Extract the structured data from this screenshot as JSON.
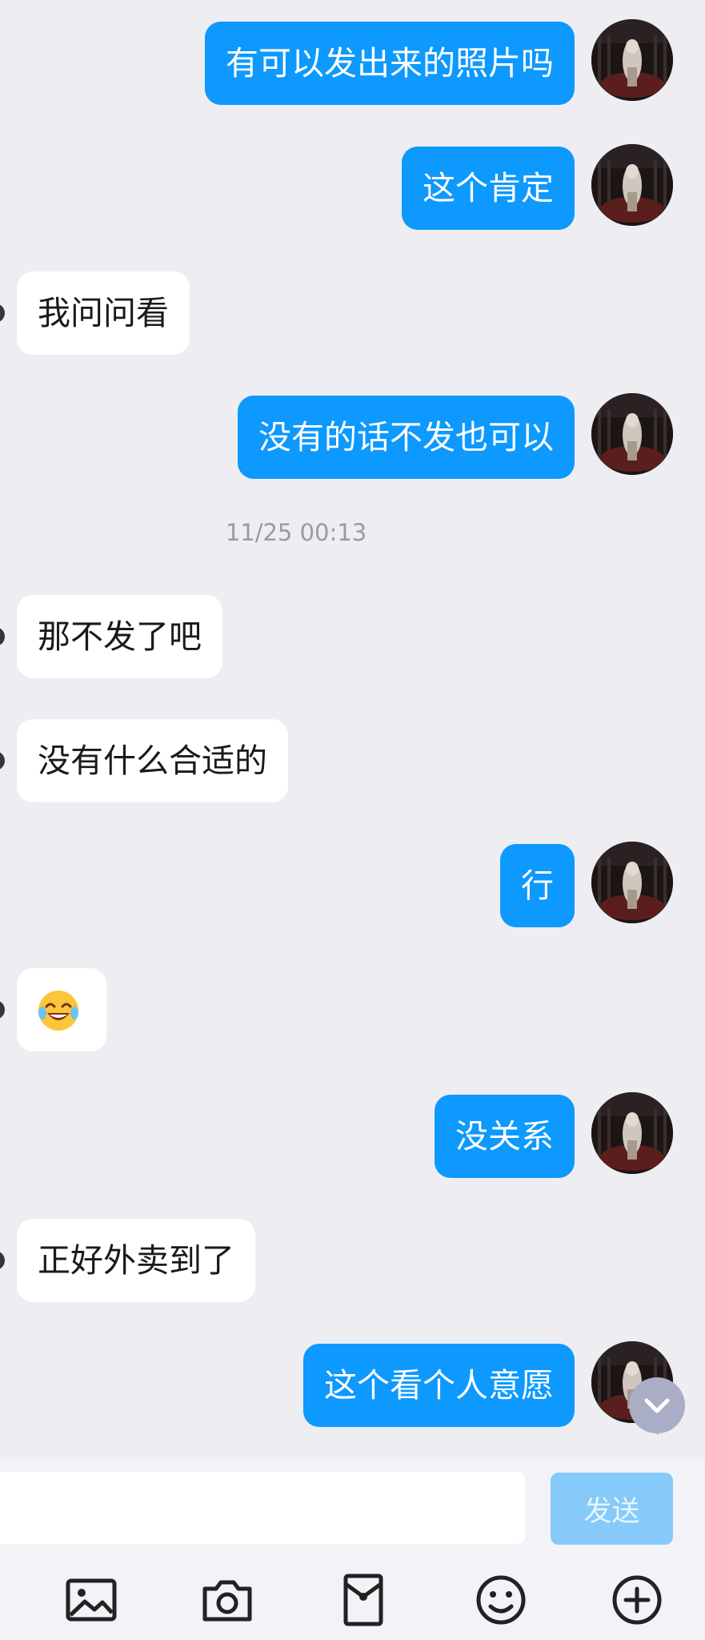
{
  "messages": [
    {
      "side": "out",
      "text": "有可以发出来的照片吗"
    },
    {
      "side": "out",
      "text": "这个肯定"
    },
    {
      "side": "in",
      "text": "我问问看"
    },
    {
      "side": "out",
      "text": "没有的话不发也可以"
    },
    {
      "side": "time",
      "text": "11/25 00:13"
    },
    {
      "side": "in",
      "text": "那不发了吧"
    },
    {
      "side": "in",
      "text": "没有什么合适的"
    },
    {
      "side": "out",
      "text": "行"
    },
    {
      "side": "in",
      "text": "",
      "emoji": "tears-of-joy-emoji"
    },
    {
      "side": "out",
      "text": "没关系"
    },
    {
      "side": "in",
      "text": "正好外卖到了"
    },
    {
      "side": "out",
      "text": "这个看个人意愿"
    }
  ],
  "composer": {
    "input_value": "",
    "send_label": "发送"
  },
  "toolbar": {
    "icons": [
      "image-icon",
      "camera-icon",
      "red-packet-icon",
      "emoji-icon",
      "add-icon"
    ]
  },
  "colors": {
    "outgoing_bubble": "#0d99fd",
    "incoming_bubble": "#ffffff",
    "background": "#ededf2",
    "send_button": "#86caf9"
  }
}
